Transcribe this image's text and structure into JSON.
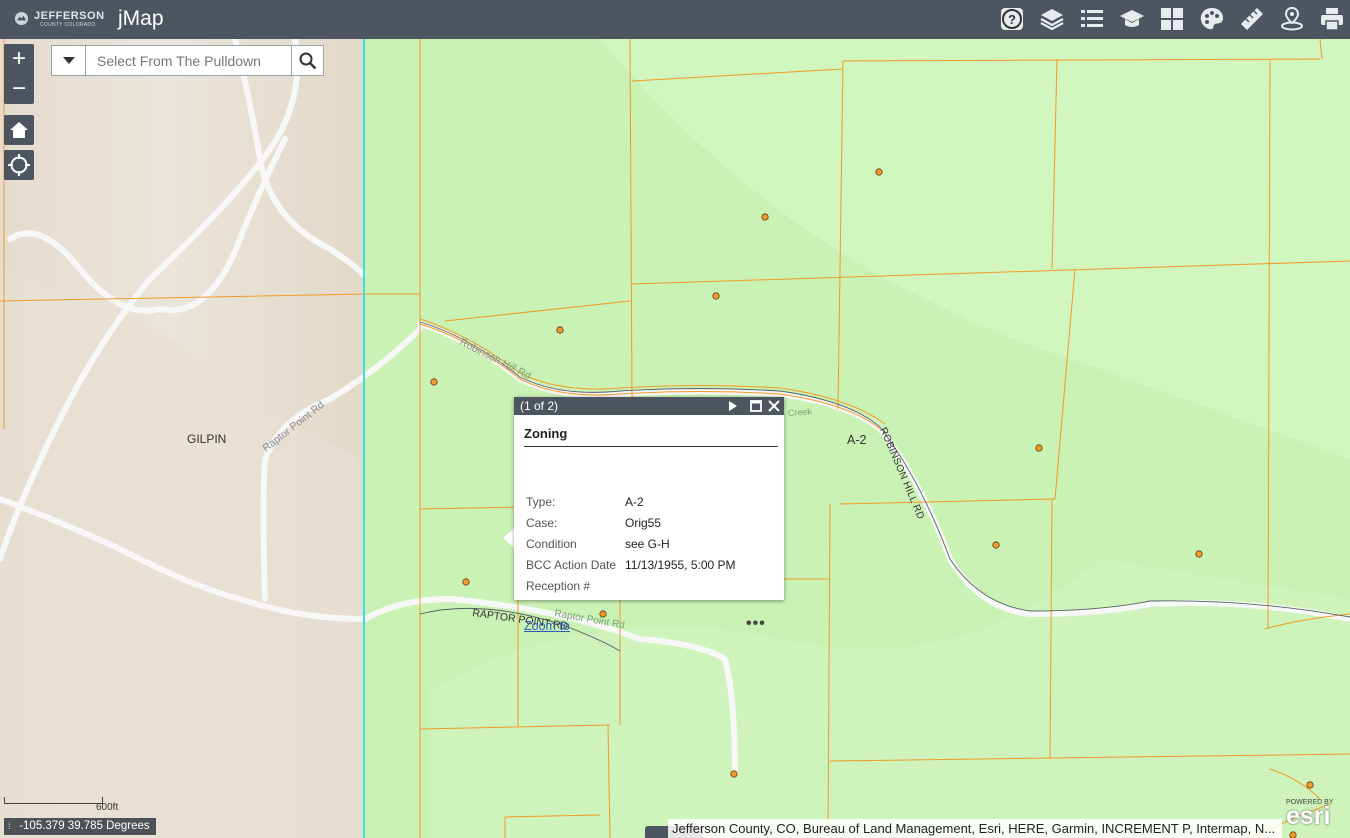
{
  "header": {
    "logo_text": "JEFFERSON",
    "logo_subtext": "COUNTY COLORADO",
    "app_title": "jMap",
    "tools": [
      "help-icon",
      "layers-icon",
      "legend-list-icon",
      "learn-cap-icon",
      "basemap-grid-icon",
      "palette-icon",
      "measure-ruler-icon",
      "location-pin-icon",
      "print-icon"
    ]
  },
  "map_controls": {
    "zoom_in": "+",
    "zoom_out": "−"
  },
  "search": {
    "placeholder": "Select From The Pulldown"
  },
  "map_labels": {
    "gilpin": "GILPIN",
    "raptor_point_gray": "Raptor Point Rd",
    "robinson_hill_gray": "Robinson Hill Rd",
    "zone": "A-2",
    "robinson_hill_upper": "ROBINSON HILL RD",
    "raptor_point_upper": "RAPTOR POINT RD",
    "raptor_point_gray2": "Raptor Point Rd",
    "creek": "Creek"
  },
  "popup": {
    "count": "(1 of 2)",
    "title": "Zoning",
    "rows": [
      {
        "label": "Type:",
        "value": "A-2"
      },
      {
        "label": "Case:",
        "value": "Orig55"
      },
      {
        "label": "Condition",
        "value": "see G-H"
      },
      {
        "label": "BCC Action Date",
        "value": "11/13/1955, 5:00 PM"
      },
      {
        "label": "Reception #",
        "value": ""
      }
    ],
    "zoom_to": "Zoom to",
    "more": "•••"
  },
  "scale": {
    "label": "600ft"
  },
  "coords": {
    "text": "-105.379 39.785 Degrees"
  },
  "attribution": "Jefferson County, CO, Bureau of Land Management, Esri, HERE, Garmin, INCREMENT P, Intermap, N...",
  "esri": {
    "powered": "POWERED BY",
    "name": "esri"
  },
  "colors": {
    "toolbar": "#4d5660",
    "parcel_line": "#f39a2a",
    "zone_fill": "#c9f2b4",
    "county_line": "#3ee0e6"
  }
}
